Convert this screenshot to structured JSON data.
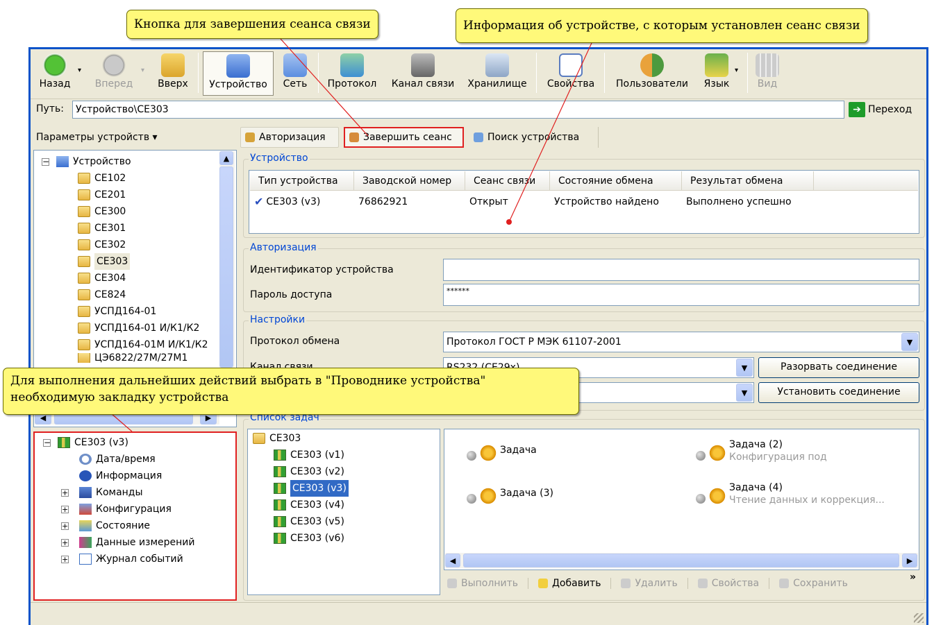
{
  "callouts": {
    "end_session": "Кнопка для завершения сеанса связи",
    "device_info": "Информация об устройстве, с которым установлен сеанс связи",
    "bookmark": "Для выполнения дальнейших действий выбрать в \"Проводнике устройства\"",
    "bookmark2": "необходимую закладку устройства"
  },
  "toolbar": {
    "back": "Назад",
    "forward": "Вперед",
    "up": "Вверх",
    "device": "Устройство",
    "network": "Сеть",
    "protocol": "Протокол",
    "channel": "Канал связи",
    "storage": "Хранилище",
    "properties": "Свойства",
    "users": "Пользователи",
    "language": "Язык",
    "view": "Вид"
  },
  "path": {
    "label": "Путь:",
    "value": "Устройство\\CE303",
    "go": "Переход"
  },
  "params": {
    "label": "Параметры устройств ▾",
    "tree_root": "Устройство",
    "items": [
      "CE102",
      "CE201",
      "CE300",
      "CE301",
      "CE302",
      "CE303",
      "CE304",
      "CE824",
      "УСПД164-01",
      "УСПД164-01 И/К1/К2",
      "УСПД164-01М И/К1/К2",
      "ЦЭ6822/27М/27М1"
    ]
  },
  "explorer": {
    "root": "CE303 (v3)",
    "items": [
      "Дата/время",
      "Информация",
      "Команды",
      "Конфигурация",
      "Состояние",
      "Данные измерений",
      "Журнал событий"
    ]
  },
  "actions": {
    "auth": "Авторизация",
    "end_session": "Завершить сеанс",
    "search": "Поиск устройства"
  },
  "device_group": {
    "title": "Устройство",
    "columns": [
      "Тип устройства",
      "Заводской номер",
      "Сеанс связи",
      "Состояние обмена",
      "Результат обмена"
    ],
    "row": [
      "CE303 (v3)",
      "76862921",
      "Открыт",
      "Устройство найдено",
      "Выполнено успешно"
    ]
  },
  "auth_group": {
    "title": "Авторизация",
    "id_label": "Идентификатор устройства",
    "id_value": "",
    "password_label": "Пароль доступа",
    "password_value": "******"
  },
  "settings_group": {
    "title": "Настройки",
    "protocol_label": "Протокол обмена",
    "protocol_value": "Протокол ГОСТ Р МЭК 61107-2001",
    "channel_label": "Канал связи",
    "channel_value": "RS232 (CE29x)",
    "disconnect": "Разорвать соединение",
    "connect": "Установить соединение"
  },
  "tasks": {
    "title": "Список задач",
    "tree_root": "CE303",
    "tree_items": [
      "CE303 (v1)",
      "CE303 (v2)",
      "CE303 (v3)",
      "CE303 (v4)",
      "CE303 (v5)",
      "CE303 (v6)"
    ],
    "task1": "Задача",
    "task2": "Задача (2)",
    "task2_desc": "Конфигурация под",
    "task3": "Задача (3)",
    "task4": "Задача (4)",
    "task4_desc": "Чтение данных и коррекция...",
    "execute": "Выполнить",
    "add": "Добавить",
    "delete": "Удалить",
    "props": "Свойства",
    "save": "Сохранить",
    "more": "»"
  },
  "colors": {
    "accent": "#0A53C9",
    "callout": "#FFF97A",
    "highlight": "#E02020"
  }
}
